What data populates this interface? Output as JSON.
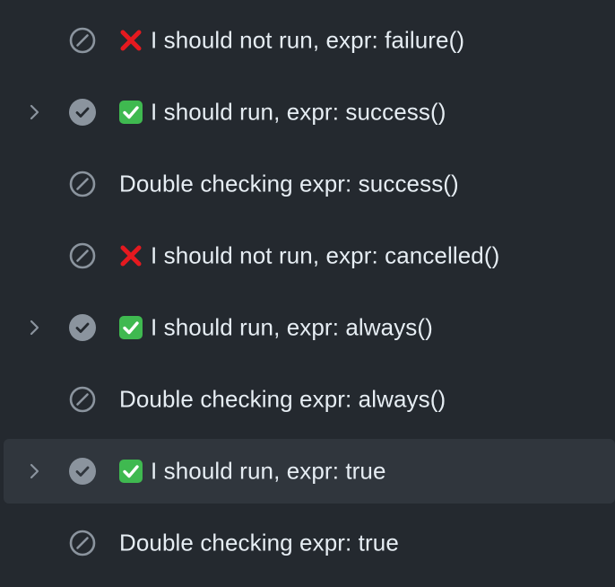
{
  "colors": {
    "background": "#24292f",
    "active_row": "#30363d",
    "text": "#e6edf3",
    "icon_gray": "#8b949e",
    "success_green": "#3fb950",
    "cross_red": "#e5191f"
  },
  "steps": [
    {
      "label": "I should not run, expr: failure()",
      "status": "skipped-icon",
      "emoji": "cross-mark-icon",
      "expandable": false,
      "active": false
    },
    {
      "label": "I should run, expr: success()",
      "status": "check-circle-icon",
      "emoji": "check-box-icon",
      "expandable": true,
      "active": false
    },
    {
      "label": "Double checking expr: success()",
      "status": "skipped-icon",
      "emoji": null,
      "expandable": false,
      "active": false
    },
    {
      "label": "I should not run, expr: cancelled()",
      "status": "skipped-icon",
      "emoji": "cross-mark-icon",
      "expandable": false,
      "active": false
    },
    {
      "label": "I should run, expr: always()",
      "status": "check-circle-icon",
      "emoji": "check-box-icon",
      "expandable": true,
      "active": false
    },
    {
      "label": "Double checking expr: always()",
      "status": "skipped-icon",
      "emoji": null,
      "expandable": false,
      "active": false
    },
    {
      "label": "I should run, expr: true",
      "status": "check-circle-icon",
      "emoji": "check-box-icon",
      "expandable": true,
      "active": true
    },
    {
      "label": "Double checking expr: true",
      "status": "skipped-icon",
      "emoji": null,
      "expandable": false,
      "active": false
    }
  ]
}
